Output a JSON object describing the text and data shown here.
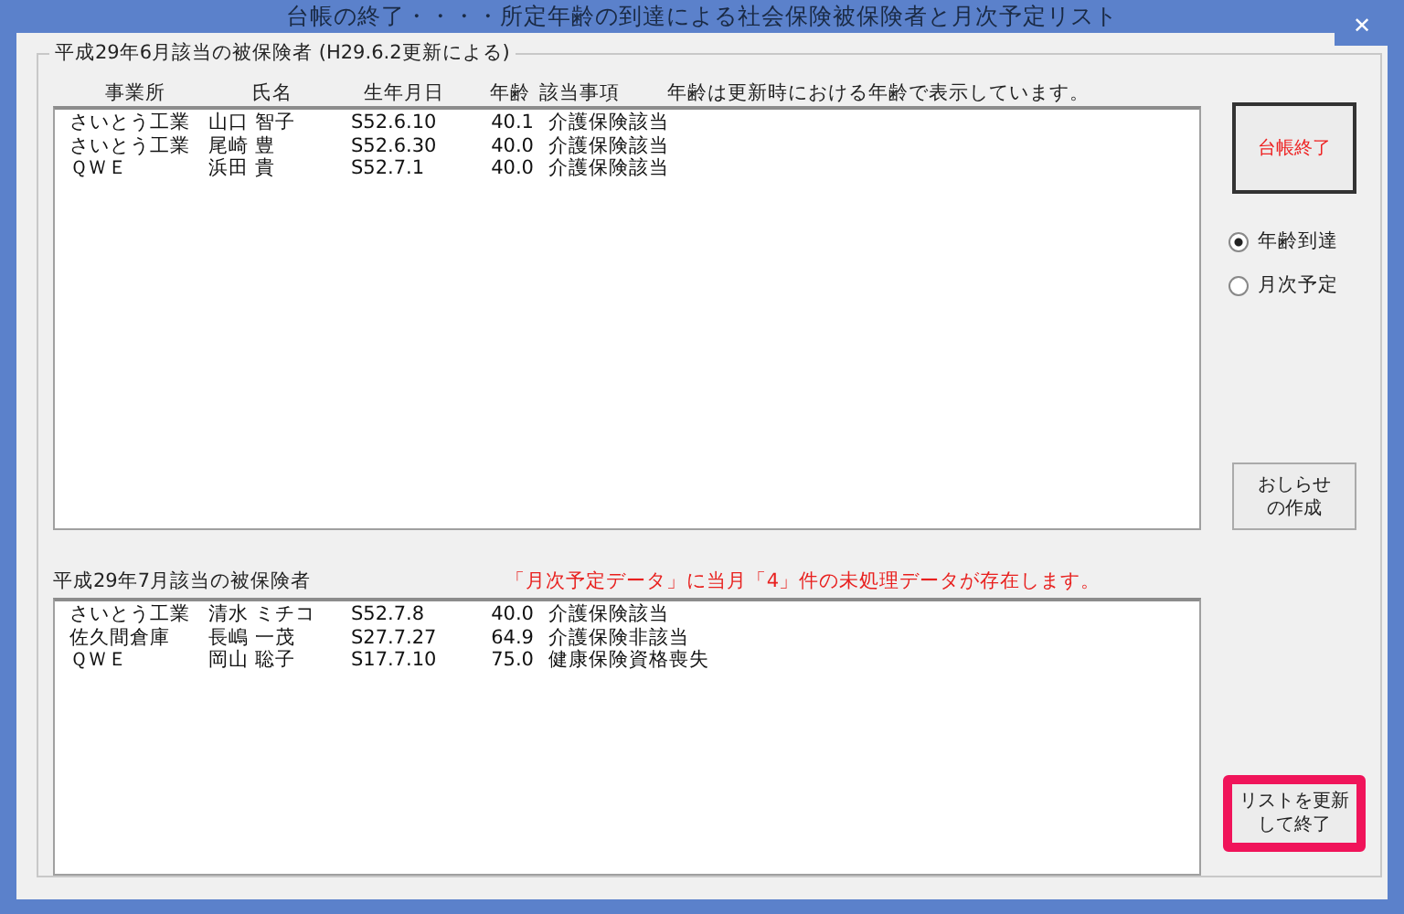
{
  "window": {
    "title": "台帳の終了・・・・所定年齢の到達による社会保険被保険者と月次予定リスト",
    "close": "✕"
  },
  "group": {
    "title": "平成29年6月該当の被保険者 (H29.6.2更新による)"
  },
  "upper": {
    "columns": [
      "事業所",
      "氏名",
      "生年月日",
      "年齢",
      "該当事項"
    ],
    "note": "年齢は更新時における年齢で表示しています。",
    "rows": [
      [
        "さいとう工業",
        "山口 智子",
        "S52.6.10",
        "40.1",
        "介護保険該当"
      ],
      [
        "さいとう工業",
        "尾崎 豊",
        "S52.6.30",
        "40.0",
        "介護保険該当"
      ],
      [
        "ＱＷＥ",
        "浜田 貴",
        "S52.7.1",
        "40.0",
        "介護保険該当"
      ]
    ]
  },
  "lower": {
    "title": "平成29年7月該当の被保険者",
    "warning": "「月次予定データ」に当月「4」件の未処理データが存在します。",
    "rows": [
      [
        "さいとう工業",
        "清水 ミチコ",
        "S52.7.8",
        "40.0",
        "介護保険該当"
      ],
      [
        "佐久間倉庫",
        "長嶋 一茂",
        "S27.7.27",
        "64.9",
        "介護保険非該当"
      ],
      [
        "ＱＷＥ",
        "岡山 聡子",
        "S17.7.10",
        "75.0",
        "健康保険資格喪失"
      ]
    ]
  },
  "end_button": {
    "label": "台帳終了"
  },
  "radios": [
    {
      "label": "年齢到達",
      "selected": true
    },
    {
      "label": "月次予定",
      "selected": false
    }
  ],
  "notice_button": {
    "lines": [
      "おしらせ",
      "の作成"
    ]
  },
  "update_button": {
    "lines": [
      "リストを更新",
      "して終了"
    ],
    "highlighted": true
  }
}
